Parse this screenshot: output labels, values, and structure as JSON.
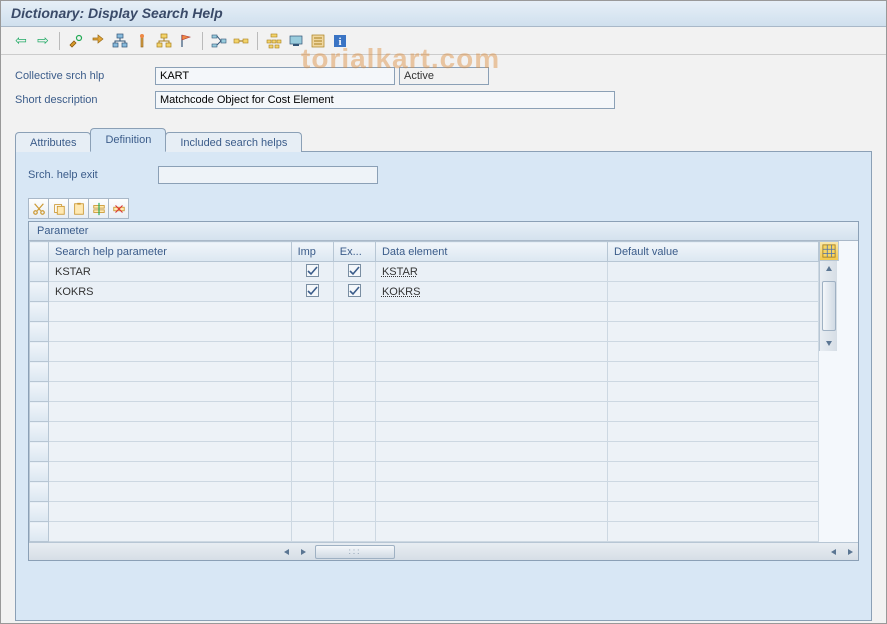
{
  "watermark": "torialkart.com",
  "title": "Dictionary: Display Search Help",
  "toolbar": {
    "back": "back-arrow",
    "forward": "forward-arrow"
  },
  "header": {
    "label_collective": "Collective srch hlp",
    "value_collective": "KART",
    "status": "Active",
    "label_shortdesc": "Short description",
    "value_shortdesc": "Matchcode Object for Cost Element"
  },
  "tabs": {
    "attributes": "Attributes",
    "definition": "Definition",
    "included": "Included search helps"
  },
  "definition": {
    "exit_label": "Srch. help exit",
    "exit_value": "",
    "grid_title": "Parameter",
    "columns": {
      "param": "Search help parameter",
      "imp": "Imp",
      "exp": "Ex...",
      "delem": "Data element",
      "default": "Default value"
    },
    "rows": [
      {
        "param": "KSTAR",
        "imp": true,
        "exp": true,
        "delem": "KSTAR",
        "default": ""
      },
      {
        "param": "KOKRS",
        "imp": true,
        "exp": true,
        "delem": "KOKRS",
        "default": ""
      }
    ],
    "empty_rows": 12
  }
}
